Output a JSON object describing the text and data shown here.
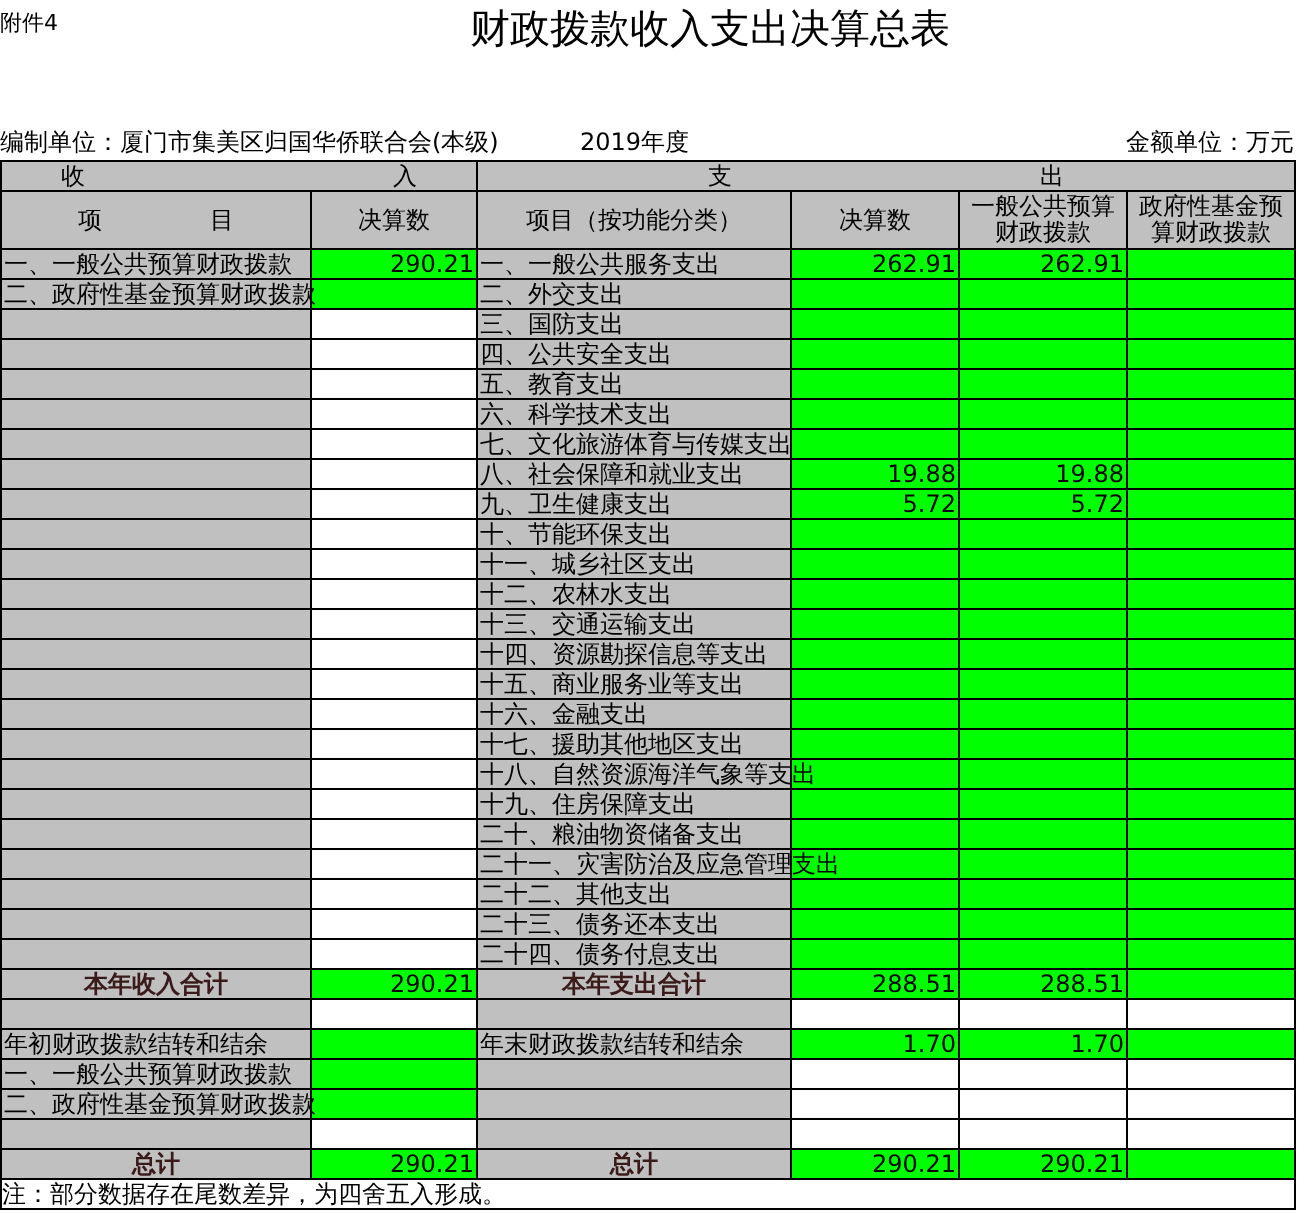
{
  "attachment": "附件4",
  "title": "财政拨款收入支出决算总表",
  "unit": "编制单位：厦门市集美区归国华侨联合会(本级)",
  "year": "2019年度",
  "currency": "金额单位：万元",
  "sections": {
    "income": "收 入",
    "expense": "支 出"
  },
  "columns": [
    "项 目",
    "决算数",
    "项目（按功能分类）",
    "决算数",
    "一般公共预算财政拨款",
    "政府性基金预算财政拨款"
  ],
  "rows": [
    {
      "kind": "item",
      "income_item": "一、一般公共预算财政拨款",
      "income_amount": "290.21",
      "income_highlighted": true,
      "expense_item": "一、一般公共服务支出",
      "expense_values": [
        "262.91",
        "262.91"
      ],
      "expense_highlighted": true
    },
    {
      "kind": "item",
      "income_item": "二、政府性基金预算财政拨款",
      "income_highlighted": true,
      "expense_item": "二、外交支出",
      "expense_highlighted": true
    },
    {
      "kind": "item",
      "income_highlighted": false,
      "expense_item": "三、国防支出",
      "expense_highlighted": true
    },
    {
      "kind": "item",
      "income_highlighted": false,
      "expense_item": "四、公共安全支出",
      "expense_highlighted": true
    },
    {
      "kind": "item",
      "income_highlighted": false,
      "expense_item": "五、教育支出",
      "expense_highlighted": true
    },
    {
      "kind": "item",
      "income_highlighted": false,
      "expense_item": "六、科学技术支出",
      "expense_highlighted": true
    },
    {
      "kind": "item",
      "income_highlighted": false,
      "expense_item": "七、文化旅游体育与传媒支出",
      "expense_highlighted": true
    },
    {
      "kind": "item",
      "income_highlighted": false,
      "expense_item": "八、社会保障和就业支出",
      "expense_values": [
        "19.88",
        "19.88"
      ],
      "expense_highlighted": true
    },
    {
      "kind": "item",
      "income_highlighted": false,
      "expense_item": "九、卫生健康支出",
      "expense_values": [
        "5.72",
        "5.72"
      ],
      "expense_highlighted": true
    },
    {
      "kind": "item",
      "income_highlighted": false,
      "expense_item": "十、节能环保支出",
      "expense_highlighted": true
    },
    {
      "kind": "item",
      "income_highlighted": false,
      "expense_item": "十一、城乡社区支出",
      "expense_highlighted": true
    },
    {
      "kind": "item",
      "income_highlighted": false,
      "expense_item": "十二、农林水支出",
      "expense_highlighted": true
    },
    {
      "kind": "item",
      "income_highlighted": false,
      "expense_item": "十三、交通运输支出",
      "expense_highlighted": true
    },
    {
      "kind": "item",
      "income_highlighted": false,
      "expense_item": "十四、资源勘探信息等支出",
      "expense_highlighted": true
    },
    {
      "kind": "item",
      "income_highlighted": false,
      "expense_item": "十五、商业服务业等支出",
      "expense_highlighted": true
    },
    {
      "kind": "item",
      "income_highlighted": false,
      "expense_item": "十六、金融支出",
      "expense_highlighted": true
    },
    {
      "kind": "item",
      "income_highlighted": false,
      "expense_item": "十七、援助其他地区支出",
      "expense_highlighted": true
    },
    {
      "kind": "item",
      "income_highlighted": false,
      "expense_item": "十八、自然资源海洋气象等支出",
      "expense_highlighted": true
    },
    {
      "kind": "item",
      "income_highlighted": false,
      "expense_item": "十九、住房保障支出",
      "expense_highlighted": true
    },
    {
      "kind": "item",
      "income_highlighted": false,
      "expense_item": "二十、粮油物资储备支出",
      "expense_highlighted": true
    },
    {
      "kind": "item",
      "income_highlighted": false,
      "expense_item": "二十一、灾害防治及应急管理支出",
      "expense_highlighted": true
    },
    {
      "kind": "item",
      "income_highlighted": false,
      "expense_item": "二十二、其他支出",
      "expense_highlighted": true
    },
    {
      "kind": "item",
      "income_highlighted": false,
      "expense_item": "二十三、债务还本支出",
      "expense_highlighted": true
    },
    {
      "kind": "item",
      "income_highlighted": false,
      "expense_item": "二十四、债务付息支出",
      "expense_highlighted": true
    },
    {
      "kind": "total",
      "income_item": "本年收入合计",
      "income_amount": "290.21",
      "income_highlighted": true,
      "expense_item": "本年支出合计",
      "expense_values": [
        "288.51",
        "288.51"
      ],
      "expense_highlighted": true
    },
    {
      "kind": "item",
      "income_highlighted": false,
      "expense_highlighted": false
    },
    {
      "kind": "item",
      "income_item": "年初财政拨款结转和结余",
      "income_highlighted": true,
      "expense_item": "年末财政拨款结转和结余",
      "expense_values": [
        "1.70",
        "1.70"
      ],
      "expense_highlighted": true
    },
    {
      "kind": "item",
      "income_item": "一、一般公共预算财政拨款",
      "income_highlighted": true,
      "expense_highlighted": false
    },
    {
      "kind": "item",
      "income_item": "二、政府性基金预算财政拨款",
      "income_highlighted": true,
      "expense_highlighted": false
    },
    {
      "kind": "item",
      "income_highlighted": false,
      "expense_highlighted": false
    },
    {
      "kind": "total",
      "income_item": "总计",
      "income_amount": "290.21",
      "income_highlighted": true,
      "expense_item": "总计",
      "expense_values": [
        "290.21",
        "290.21"
      ],
      "expense_highlighted": true
    }
  ],
  "note": "注：部分数据存在尾数差异，为四舍五入形成。"
}
